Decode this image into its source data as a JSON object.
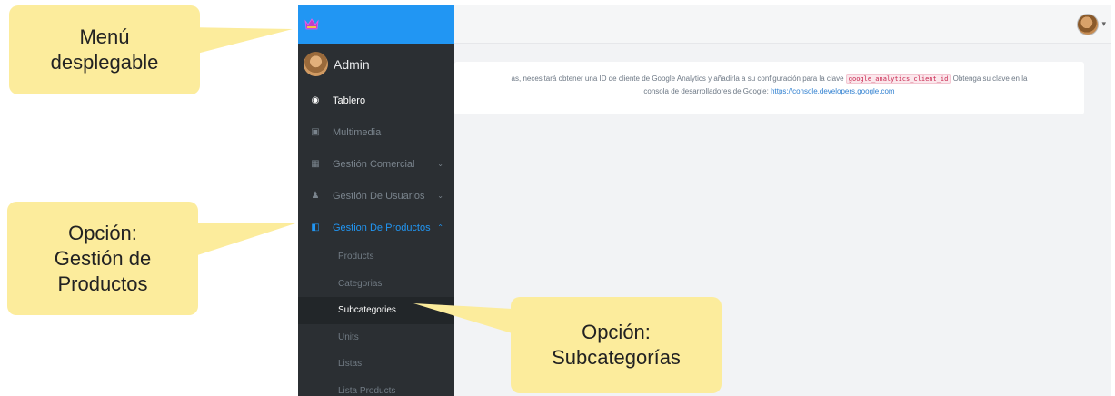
{
  "topbar": {
    "avatar_icon": "user-avatar-icon",
    "caret": "▾"
  },
  "sidebar": {
    "brand_color": "#2196f3",
    "profile": {
      "name": "Admin"
    },
    "items": [
      {
        "label": "Tablero",
        "icon": "dashboard-icon",
        "glyph": "◉",
        "state": "active"
      },
      {
        "label": "Multimedia",
        "icon": "image-icon",
        "glyph": "▣",
        "state": "normal"
      },
      {
        "label": "Gestión Comercial",
        "icon": "store-icon",
        "glyph": "▦",
        "chevron": "⌄",
        "state": "normal"
      },
      {
        "label": "Gestión De Usuarios",
        "icon": "users-icon",
        "glyph": "♟",
        "chevron": "⌄",
        "state": "normal"
      },
      {
        "label": "Gestion De Productos",
        "icon": "book-icon",
        "glyph": "◧",
        "chevron": "⌃",
        "state": "open"
      }
    ],
    "subitems": [
      "Products",
      "Categorias",
      "Subcategories",
      "Units",
      "Listas",
      "Lista Products"
    ],
    "active_subitem": "Subcategories"
  },
  "alert": {
    "text_before": "as, necesitará obtener una ID de cliente de Google Analytics y añadirla a su configuración para la clave",
    "code": "google_analytics_client_id",
    "text_after": "Obtenga su clave en la",
    "line2": "consola de desarrolladores de Google:",
    "link": "https://console.developers.google.com"
  },
  "callouts": {
    "menu": "Menú desplegable",
    "productos_line1": "Opción:",
    "productos_line2": "Gestión de",
    "productos_line3": "Productos",
    "sub_line1": "Opción:",
    "sub_line2": "Subcategorías"
  },
  "colors": {
    "callout": "#fcec9c",
    "sidebar": "#2b2f33",
    "accent": "#2196f3"
  }
}
